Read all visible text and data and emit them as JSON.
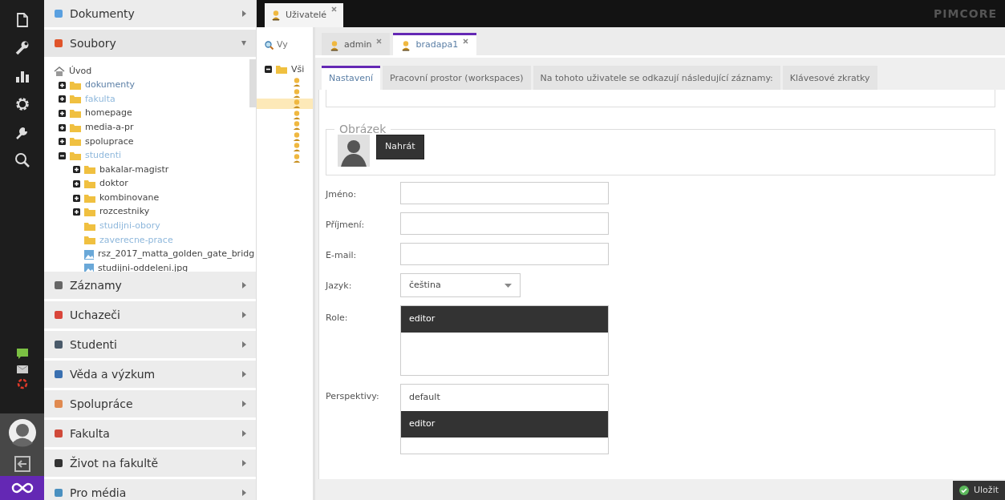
{
  "accordion": [
    {
      "label": "Dokumenty",
      "color": "#5aa0e0",
      "expanded": false
    },
    {
      "label": "Soubory",
      "color": "#e0542a",
      "expanded": true,
      "tree": {
        "label": "Úvod",
        "kind": "home",
        "color": "#444444",
        "children": [
          {
            "label": "dokumenty",
            "kind": "folder",
            "color": "#5b7fa6",
            "expanded": false
          },
          {
            "label": "fakulta",
            "kind": "folder",
            "color": "#8fb8dc",
            "expanded": false
          },
          {
            "label": "homepage",
            "kind": "folder",
            "color": "#444444",
            "expanded": false
          },
          {
            "label": "media-a-pr",
            "kind": "folder",
            "color": "#444444",
            "expanded": false
          },
          {
            "label": "spoluprace",
            "kind": "folder",
            "color": "#444444",
            "expanded": false
          },
          {
            "label": "studenti",
            "kind": "folder",
            "color": "#8fb8dc",
            "expanded": true,
            "children": [
              {
                "label": "bakalar-magistr",
                "kind": "folder",
                "color": "#444444",
                "expanded": false
              },
              {
                "label": "doktor",
                "kind": "folder",
                "color": "#444444",
                "expanded": false
              },
              {
                "label": "kombinovane",
                "kind": "folder",
                "color": "#444444",
                "expanded": false
              },
              {
                "label": "rozcestniky",
                "kind": "folder",
                "color": "#444444",
                "expanded": false
              },
              {
                "label": "studijni-obory",
                "kind": "folder",
                "color": "#8fb8dc"
              },
              {
                "label": "zaverecne-prace",
                "kind": "folder",
                "color": "#8fb8dc"
              },
              {
                "label": "rsz_2017_matta_golden_gate_bridg",
                "kind": "image",
                "color": "#444444"
              },
              {
                "label": "studijni-oddeleni.jpg",
                "kind": "image",
                "color": "#444444"
              }
            ]
          }
        ]
      }
    },
    {
      "label": "Záznamy",
      "color": "#666666",
      "expanded": false
    },
    {
      "label": "Uchazeči",
      "color": "#d9453a",
      "expanded": false
    },
    {
      "label": "Studenti",
      "color": "#4a5a6a",
      "expanded": false
    },
    {
      "label": "Věda a výzkum",
      "color": "#3a70b0",
      "expanded": false
    },
    {
      "label": "Spolupráce",
      "color": "#e08a50",
      "expanded": false
    },
    {
      "label": "Fakulta",
      "color": "#d04a3a",
      "expanded": false
    },
    {
      "label": "Život na fakultě",
      "color": "#333333",
      "expanded": false
    },
    {
      "label": "Pro média",
      "color": "#4a90c0",
      "expanded": false
    }
  ],
  "main_tabs": [
    {
      "label": "Uživatelé",
      "selected": true
    }
  ],
  "logo": "PIMCORE",
  "users_panel": {
    "search": {
      "placeholder": "Vy"
    },
    "root": {
      "label": "Vši",
      "expanded": true
    },
    "users": [
      {
        "selected": false
      },
      {
        "selected": false
      },
      {
        "selected": true
      },
      {
        "selected": false
      },
      {
        "selected": false
      },
      {
        "selected": false
      },
      {
        "selected": false
      },
      {
        "selected": false
      }
    ]
  },
  "user_tabs": [
    {
      "label": "admin",
      "selected": false
    },
    {
      "label": "bradapa1",
      "selected": true
    }
  ],
  "settings_tabs": [
    {
      "label": "Nastavení",
      "selected": true
    },
    {
      "label": "Pracovní prostor (workspaces)",
      "selected": false
    },
    {
      "label": "Na tohoto uživatele se odkazují následující záznamy:",
      "selected": false
    },
    {
      "label": "Klávesové zkratky",
      "selected": false
    }
  ],
  "form": {
    "image_legend": "Obrázek",
    "upload_button": "Nahrát",
    "fields": [
      {
        "kind": "text",
        "label": "Jméno:"
      },
      {
        "kind": "text",
        "label": "Příjmení:"
      },
      {
        "kind": "text",
        "label": "E-mail:"
      },
      {
        "kind": "select",
        "label": "Jazyk:",
        "value": "čeština"
      },
      {
        "kind": "list",
        "label": "Role:",
        "options": [
          {
            "label": "editor",
            "selected": true
          }
        ]
      },
      {
        "kind": "list",
        "label": "Perspektivy:",
        "options": [
          {
            "label": "default",
            "selected": false
          },
          {
            "label": "editor",
            "selected": true
          }
        ]
      }
    ]
  },
  "save_button": "Uložit"
}
